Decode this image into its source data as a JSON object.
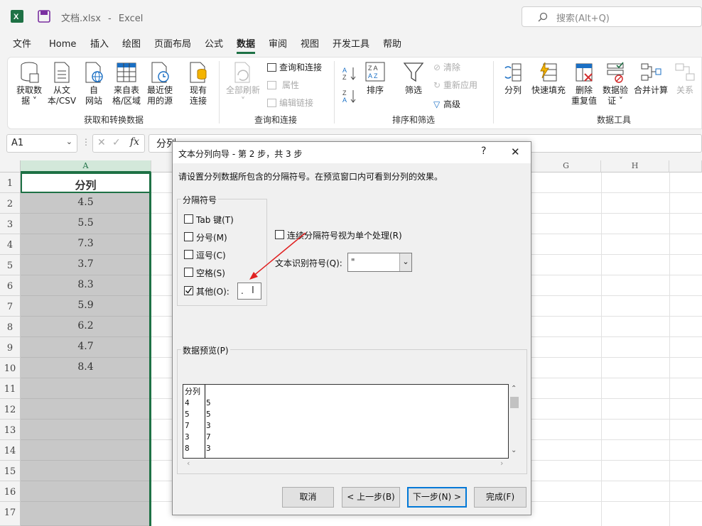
{
  "app": {
    "file_title": "文档.xlsx",
    "title_sep": "-",
    "app_name": "Excel",
    "search_placeholder": "搜索(Alt+Q)"
  },
  "menu": [
    "文件",
    "Home",
    "插入",
    "绘图",
    "页面布局",
    "公式",
    "数据",
    "审阅",
    "视图",
    "开发工具",
    "帮助"
  ],
  "ribbon": {
    "get_data": {
      "btn_get_data": [
        "获取数",
        "据 ˅"
      ],
      "btn_from_text": [
        "从文",
        "本/CSV"
      ],
      "btn_from_web": [
        "自",
        "网站"
      ],
      "btn_from_table": [
        "来自表",
        "格/区域"
      ],
      "btn_recent": [
        "最近使",
        "用的源"
      ],
      "btn_existing": [
        "现有",
        "连接"
      ],
      "label": "获取和转换数据"
    },
    "queries": {
      "refresh": [
        "全部刷新",
        "˅"
      ],
      "q_and_c": "查询和连接",
      "properties": "属性",
      "edit_links": "编辑链接",
      "label": "查询和连接"
    },
    "sort": {
      "sort": "排序",
      "filter": "筛选",
      "clear": "清除",
      "reapply": "重新应用",
      "advanced": "高级",
      "label": "排序和筛选"
    },
    "tools": {
      "split": "分列",
      "flash_fill": "快速填充",
      "remove_dup": [
        "删除",
        "重复值"
      ],
      "validation": [
        "数据验",
        "证 ˅"
      ],
      "consolidate": "合并计算",
      "relations": "关系",
      "label": "数据工具"
    }
  },
  "formula_bar": {
    "name_box": "A1",
    "fx": "fx",
    "content": "分列"
  },
  "sheet": {
    "col_a": "A",
    "col_g": "G",
    "col_h": "H",
    "rows": [
      "1",
      "2",
      "3",
      "4",
      "5",
      "6",
      "7",
      "8",
      "9",
      "10",
      "11",
      "12",
      "13",
      "14",
      "15",
      "16",
      "17"
    ],
    "a_values": [
      "分列",
      "4.5",
      "5.5",
      "7.3",
      "3.7",
      "8.3",
      "5.9",
      "6.2",
      "4.7",
      "8.4"
    ]
  },
  "dialog": {
    "title": "文本分列向导 - 第 2 步，共 3 步",
    "help": "?",
    "close": "✕",
    "instruction": "请设置分列数据所包含的分隔符号。在预览窗口内可看到分列的效果。",
    "delim_group": "分隔符号",
    "opt_tab": "Tab 键(T)",
    "opt_semicolon": "分号(M)",
    "opt_comma": "逗号(C)",
    "opt_space": "空格(S)",
    "opt_other": "其他(O):",
    "other_value": ".",
    "consecutive": "连续分隔符号视为单个处理(R)",
    "qualifier_label": "文本识别符号(Q):",
    "qualifier_value": "\"",
    "preview_label": "数据预览(P)",
    "preview_rows": [
      [
        "分列",
        ""
      ],
      [
        "4",
        "5"
      ],
      [
        "5",
        "5"
      ],
      [
        "7",
        "3"
      ],
      [
        "3",
        "7"
      ],
      [
        "8",
        "3"
      ]
    ],
    "btn_cancel": "取消",
    "btn_back": "< 上一步(B)",
    "btn_next": "下一步(N) >",
    "btn_finish": "完成(F)",
    "checked": {
      "tab": false,
      "semicolon": false,
      "comma": false,
      "space": false,
      "other": true,
      "consecutive": false
    }
  },
  "colors": {
    "excel_green": "#1e7145",
    "arrow_red": "#e02020",
    "accent_blue": "#0078d7"
  }
}
